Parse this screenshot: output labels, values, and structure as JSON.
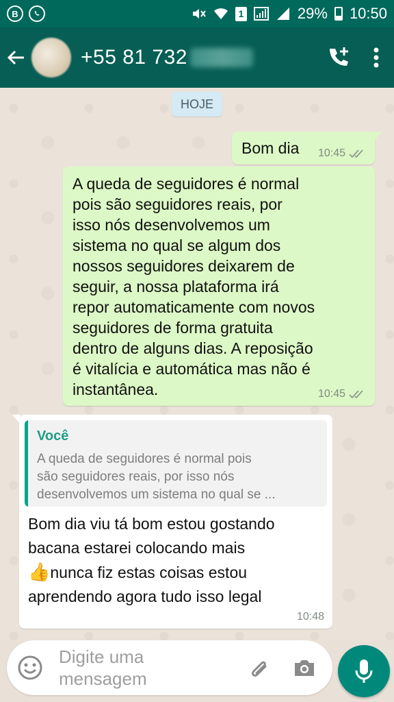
{
  "status_bar": {
    "left_icons": [
      "B",
      "whatsapp-icon"
    ],
    "sim": "1",
    "battery": "29%",
    "time": "10:50"
  },
  "app_bar": {
    "contact_visible": "+55 81 732",
    "icons": [
      "back-arrow-icon",
      "add-call-icon",
      "more-vert-icon"
    ]
  },
  "chat": {
    "date_chip": "HOJE",
    "messages": [
      {
        "direction": "outgoing",
        "text": "Bom dia",
        "time": "10:45",
        "status": "delivered"
      },
      {
        "direction": "outgoing",
        "lines": [
          "A queda de seguidores é normal",
          "pois são seguidores reais, por",
          "isso nós desenvolvemos um",
          "sistema no qual se algum dos",
          "nossos seguidores deixarem de",
          "seguir, a nossa plataforma irá",
          "repor automaticamente com novos",
          "seguidores de forma gratuita",
          "dentro de alguns dias. A reposição",
          "é vitalícia e automática mas não é",
          "instantânea."
        ],
        "time": "10:45",
        "status": "delivered"
      },
      {
        "direction": "incoming",
        "quote": {
          "author": "Você",
          "lines": [
            "A queda de seguidores é normal pois",
            "são seguidores reais, por isso nós",
            "desenvolvemos um sistema no qual se ..."
          ]
        },
        "lines": [
          "Bom dia viu tá bom estou gostando",
          "bacana estarei colocando mais",
          "nunca fiz estas coisas estou",
          "aprendendo agora tudo isso legal"
        ],
        "emoji": "👍",
        "time": "10:48"
      }
    ]
  },
  "composer": {
    "placeholder_line1": "Digite uma",
    "placeholder_line2": "mensagem",
    "icons": [
      "emoji-icon",
      "attach-icon",
      "camera-icon",
      "mic-icon"
    ]
  },
  "colors": {
    "header": "#075e54",
    "statusbar": "#00695c",
    "outgoing_bubble": "#dcf8c6",
    "accent": "#00897b"
  }
}
